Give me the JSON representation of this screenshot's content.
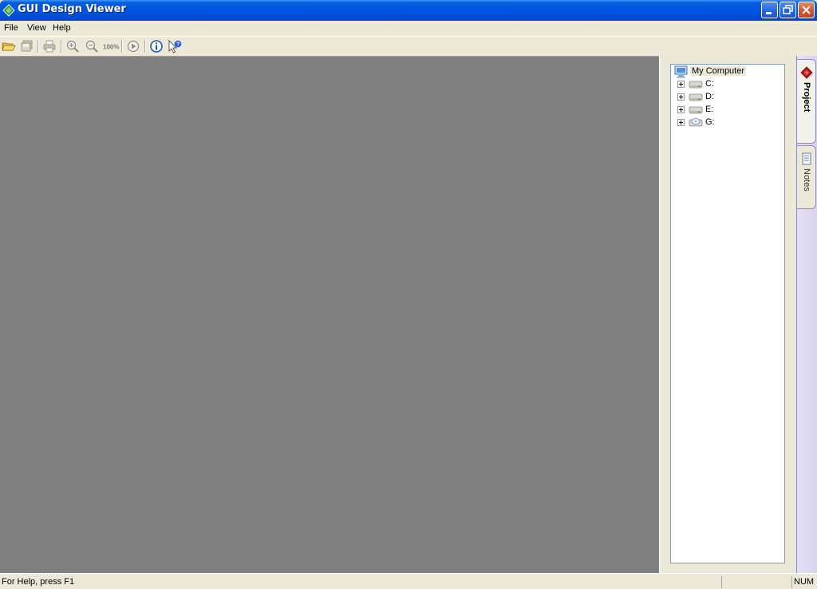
{
  "window": {
    "title": "GUI Design Viewer",
    "app_icon": "green-diamond-icon",
    "titlebar_color": "#0054e3"
  },
  "menu": {
    "items": [
      {
        "label": "File"
      },
      {
        "label": "View"
      },
      {
        "label": "Help"
      }
    ]
  },
  "toolbar": {
    "buttons": [
      {
        "icon": "open-folder-icon"
      },
      {
        "icon": "save-icon"
      },
      {
        "icon": "print-icon"
      },
      {
        "icon": "zoom-in-icon"
      },
      {
        "icon": "zoom-out-icon"
      },
      {
        "icon": "zoom-100-icon",
        "label": "100%"
      },
      {
        "icon": "play-icon"
      },
      {
        "icon": "info-icon"
      },
      {
        "icon": "context-help-icon"
      }
    ]
  },
  "canvas": {
    "background": "#808080"
  },
  "tree": {
    "root": {
      "label": "My Computer",
      "icon": "computer-icon"
    },
    "drives": [
      {
        "label": "C:",
        "icon": "hard-drive-icon"
      },
      {
        "label": "D:",
        "icon": "hard-drive-icon"
      },
      {
        "label": "E:",
        "icon": "hard-drive-icon"
      },
      {
        "label": "G:",
        "icon": "cd-drive-icon"
      }
    ]
  },
  "tabs": [
    {
      "label": "Project",
      "icon": "red-diamond-icon",
      "active": true
    },
    {
      "label": "Notes",
      "icon": "notes-icon",
      "active": false
    }
  ],
  "statusbar": {
    "text": "For Help, press F1",
    "indicator": "NUM"
  }
}
